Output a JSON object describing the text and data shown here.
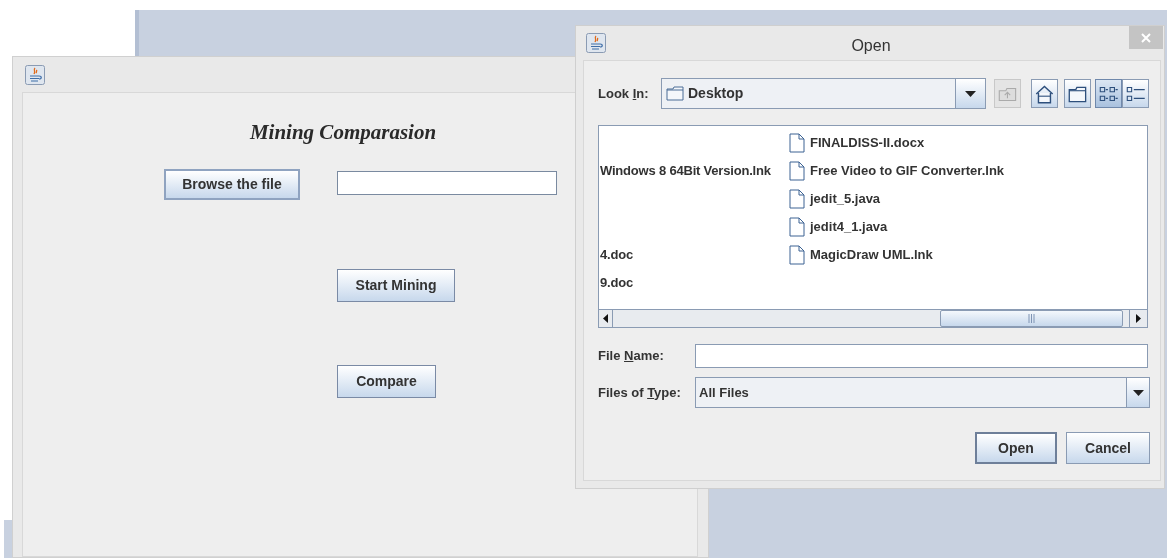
{
  "main_window": {
    "heading": "Mining Comparasion",
    "browse_button": "Browse the file",
    "buttons": [
      "Start Mining",
      "Compare"
    ]
  },
  "dialog": {
    "title": "Open",
    "look_in": {
      "label": {
        "before": "Look ",
        "key": "I",
        "after": "n:"
      },
      "value": "Desktop"
    },
    "toolbar": [
      {
        "kind": "up",
        "disabled": true,
        "selected": false
      },
      {
        "kind": "home",
        "disabled": false,
        "selected": false
      },
      {
        "kind": "new_folder",
        "disabled": false,
        "selected": false
      },
      {
        "kind": "list",
        "disabled": false,
        "selected": true
      },
      {
        "kind": "details",
        "disabled": false,
        "selected": false
      }
    ],
    "file_list": {
      "rows": [
        {
          "column_2": "FINALDISS-II.docx"
        },
        {
          "column_1": "Windows 8 64Bit Version.lnk",
          "column_2": "Free Video to GIF Converter.lnk"
        },
        {
          "column_2": "jedit_5.java"
        },
        {
          "column_2": "jedit4_1.java"
        },
        {
          "column_1": "4.doc",
          "column_2": "MagicDraw UML.lnk"
        },
        {
          "column_1": "9.doc"
        }
      ]
    },
    "file_name": {
      "label": {
        "before": "File ",
        "key": "N",
        "after": "ame:"
      }
    },
    "file_type": {
      "label": {
        "before": "Files of ",
        "key": "T",
        "after": "ype:"
      },
      "value": "All Files"
    },
    "buttons": [
      {
        "label": "Open",
        "default": true
      },
      {
        "label": "Cancel",
        "default": false
      }
    ]
  }
}
